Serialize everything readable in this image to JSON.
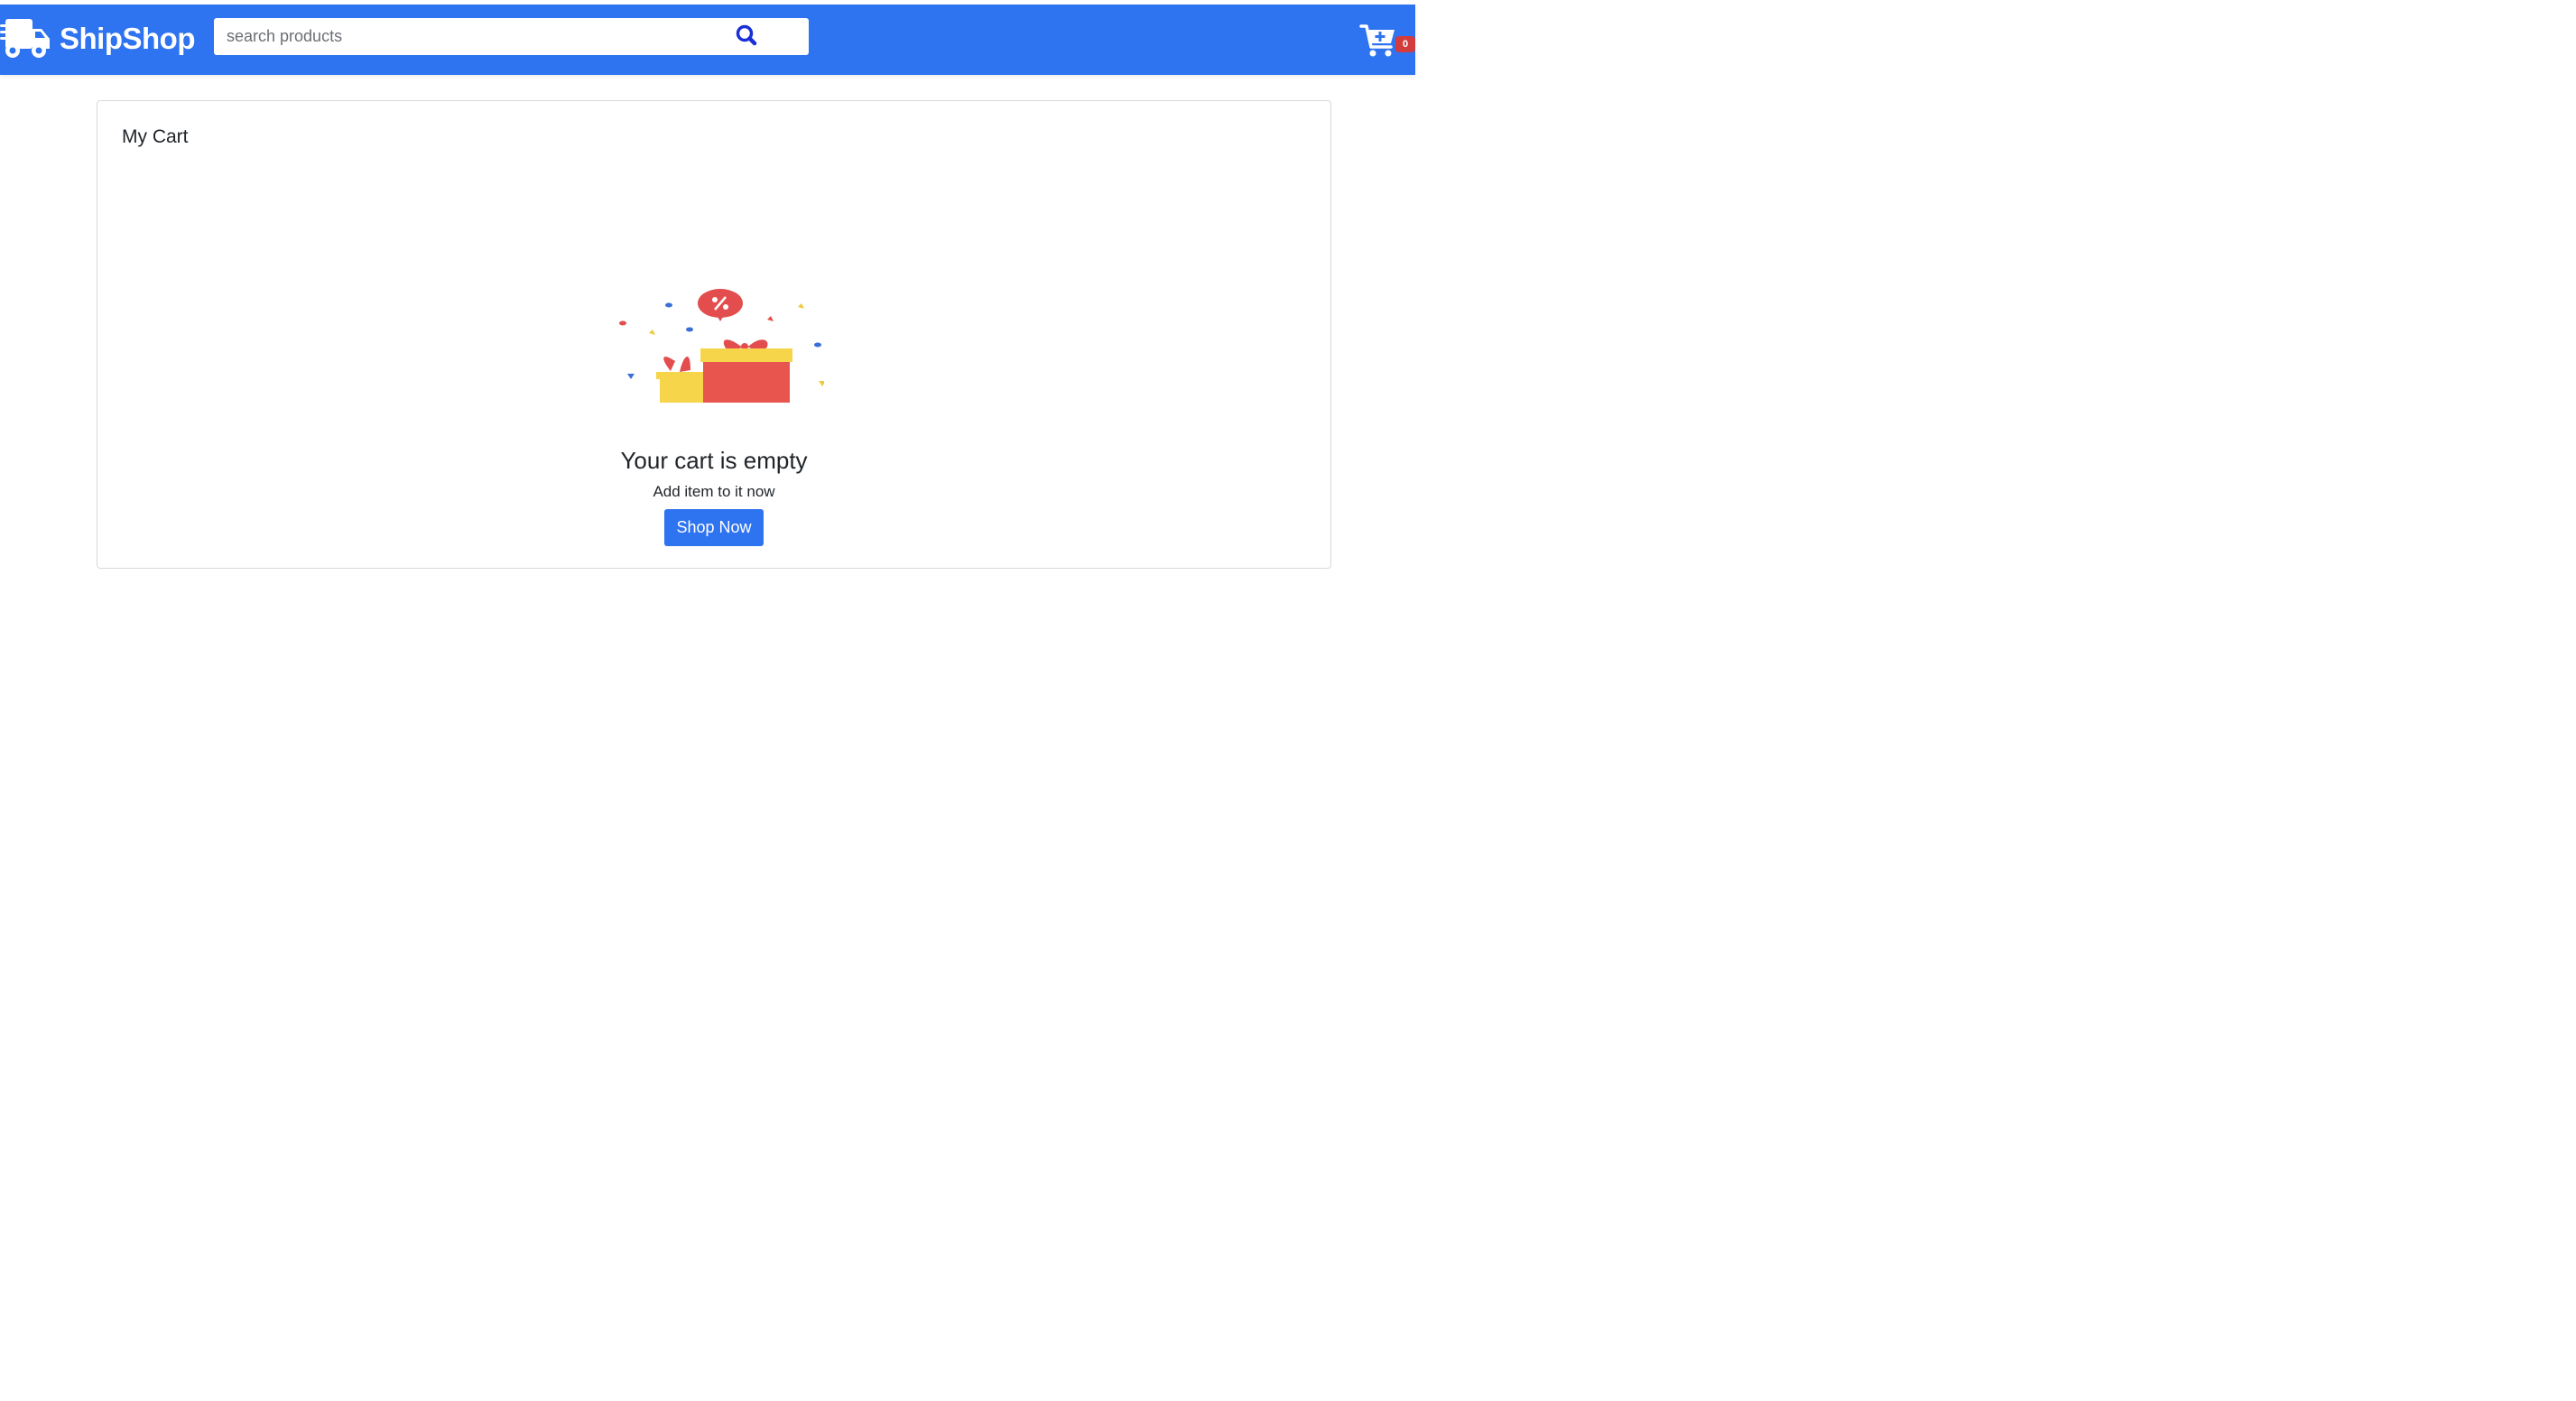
{
  "header": {
    "brand_name": "ShipShop",
    "logo_icon": "delivery-truck-icon",
    "search": {
      "placeholder": "search products",
      "value": "",
      "button_icon": "search-icon"
    },
    "cart": {
      "icon": "cart-plus-icon",
      "count": "0"
    }
  },
  "cart_page": {
    "title": "My Cart",
    "illustration": "gift-boxes-confetti-illustration",
    "empty_title": "Your cart is empty",
    "empty_subtitle": "Add item to it now",
    "shop_button_label": "Shop Now"
  },
  "colors": {
    "primary": "#2e73ef",
    "badge": "#d33c3c",
    "search_icon": "#1a2fd6"
  }
}
